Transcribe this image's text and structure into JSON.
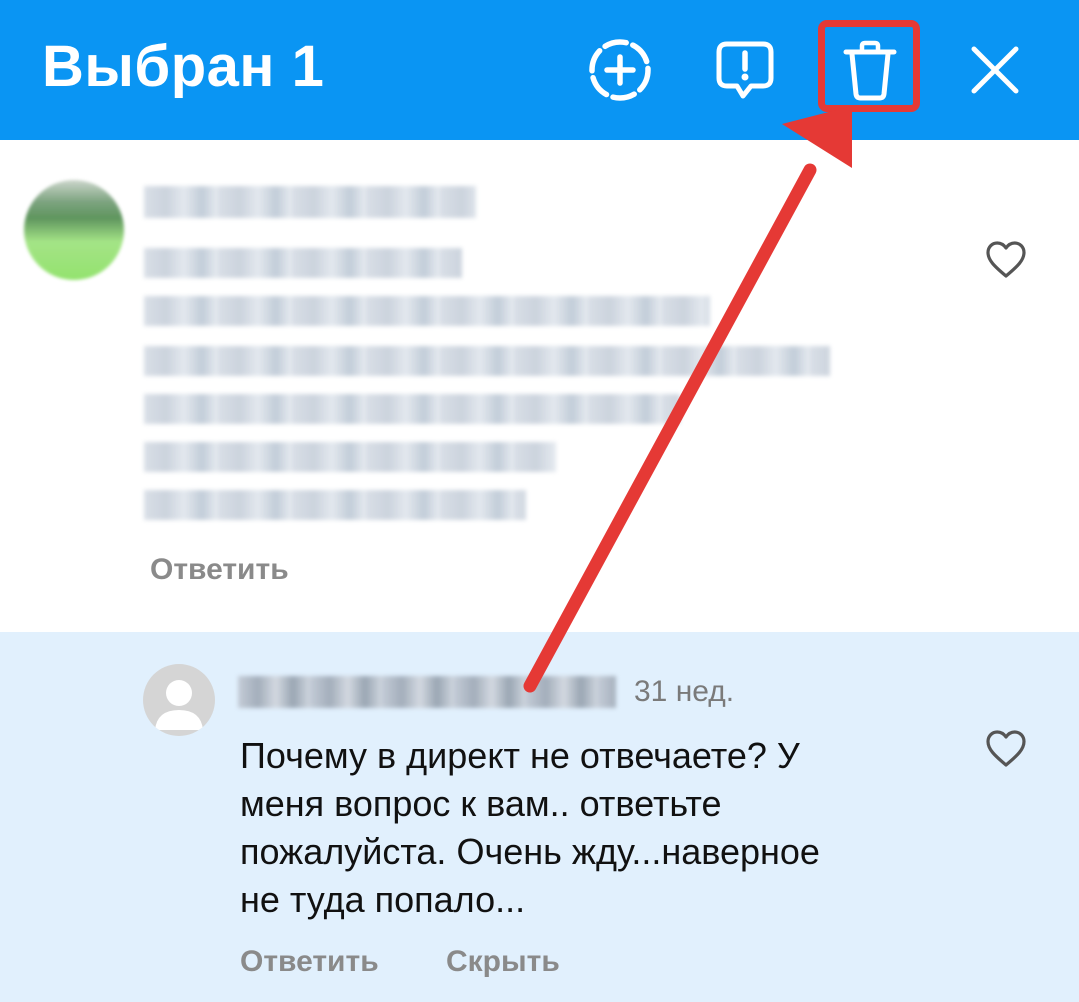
{
  "header": {
    "title": "Выбран 1",
    "background_color": "#0a95f3",
    "icons": [
      "add-story-icon",
      "report-icon",
      "trash-icon",
      "close-icon"
    ]
  },
  "annotation": {
    "color": "#e53935",
    "target": "delete-button"
  },
  "comments": [
    {
      "reply_label": "Ответить",
      "liked": false
    },
    {
      "timestamp": "31 нед.",
      "text": "Почему в директ не отвечаете? У\nменя вопрос к вам.. ответьте\nпожалуйста. Очень жду...наверное\nне туда попало...",
      "reply_label": "Ответить",
      "hide_label": "Скрыть",
      "selected": true,
      "highlight_color": "#e1f0fd",
      "liked": false
    }
  ]
}
